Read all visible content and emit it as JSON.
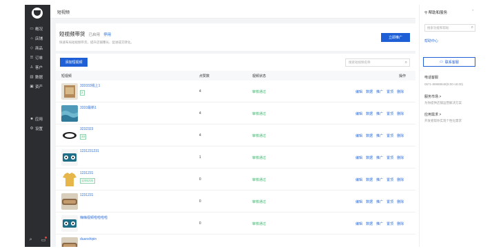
{
  "sidebar": {
    "items": [
      {
        "icon": "monitor-icon",
        "glyph": "▭",
        "label": "概况"
      },
      {
        "icon": "store-icon",
        "glyph": "⌂",
        "label": "店铺"
      },
      {
        "icon": "tag-icon",
        "glyph": "◇",
        "label": "商品"
      },
      {
        "icon": "order-icon",
        "glyph": "☰",
        "label": "订单"
      },
      {
        "icon": "user-icon",
        "glyph": "♙",
        "label": "客户"
      },
      {
        "icon": "chart-icon",
        "glyph": "▥",
        "label": "数据"
      },
      {
        "icon": "asset-icon",
        "glyph": "▣",
        "label": "资产"
      },
      {
        "icon": "apps-icon",
        "glyph": "■",
        "label": "应用"
      },
      {
        "icon": "settings-icon",
        "glyph": "⚙",
        "label": "设置"
      }
    ]
  },
  "header": {
    "breadcrumb": "短视频"
  },
  "intro": {
    "title": "短视频带货",
    "status": "已启用",
    "stop_label": "停用",
    "desc": "快速布局短视频带货，提升店铺曝光、促进成交转化。",
    "promote_label": "立即推广"
  },
  "list": {
    "add_label": "添加短视频",
    "search_placeholder": "搜索短视频名称",
    "columns": {
      "video": "短视频",
      "likes": "点赞数",
      "status": "视频状态",
      "ops": "操作"
    },
    "ops": [
      "编辑",
      "数据",
      "推广",
      "置顶",
      "删除"
    ],
    "rows": [
      {
        "name": "333333钱上1",
        "tag": "2",
        "likes": "4",
        "status": "审核通过",
        "thumb": "kraft"
      },
      {
        "name": "3333最新1",
        "tag": "",
        "likes": "4",
        "status": "审核通过",
        "thumb": "ocean"
      },
      {
        "name": "3232323",
        "tag": "33",
        "likes": "4",
        "status": "审核通过",
        "thumb": "logo"
      },
      {
        "name": "1231231231",
        "tag": "",
        "likes": "1",
        "status": "审核通过",
        "thumb": "cartoon"
      },
      {
        "name": "1231231",
        "tag": "1231231",
        "likes": "0",
        "status": "审核通过",
        "thumb": "shirt"
      },
      {
        "name": "1231231",
        "tag": "",
        "likes": "0",
        "status": "审核通过",
        "thumb": "bread"
      },
      {
        "name": "嗨嗨视频啦啦啦啦",
        "tag": "",
        "likes": "0",
        "status": "审核通过",
        "thumb": "cartoon"
      },
      {
        "name": "duanshipin",
        "tag": "",
        "likes": "",
        "status": "",
        "thumb": "bread"
      }
    ]
  },
  "help_panel": {
    "title": "帮助和服务",
    "search_placeholder": "搜索功能和帮助",
    "help_center": "帮助中心",
    "contact_label": "联系客服",
    "phone_title": "电话客服",
    "phone_value": "0571-89988848(9:00-18:00)",
    "market_title": "服务市场 >",
    "market_desc": "为你提供店铺运营解决方案",
    "demand_title": "应用需求 >",
    "demand_desc": "开发者帮你实现个性化需求"
  },
  "colors": {
    "brand": "#1f5fd6",
    "success": "#3db36e",
    "sidebar": "#2c2d30"
  }
}
